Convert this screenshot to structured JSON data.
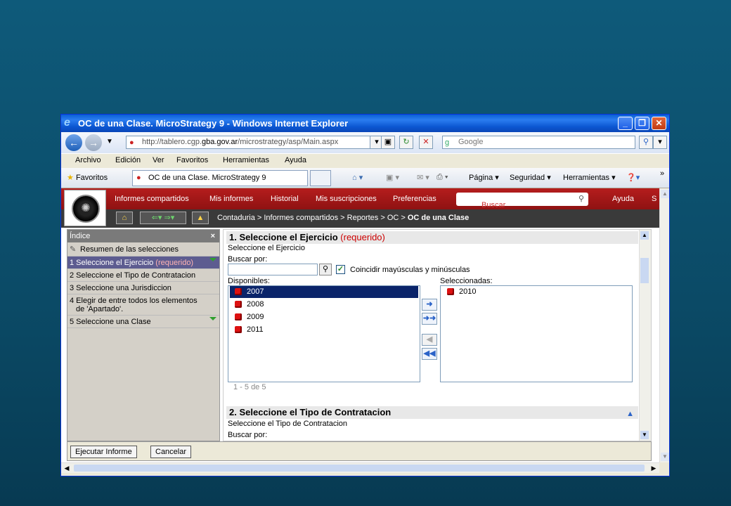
{
  "window": {
    "title": "OC de una Clase. MicroStrategy 9 - Windows Internet Explorer"
  },
  "address": {
    "url_prefix": "http://tablero.cgp.",
    "url_domain": "gba.gov.ar",
    "url_suffix": "/microstrategy/asp/Main.aspx",
    "search_placeholder": "Google"
  },
  "menubar": [
    "Archivo",
    "Edición",
    "Ver",
    "Favoritos",
    "Herramientas",
    "Ayuda"
  ],
  "favbar": {
    "favorites": "Favoritos",
    "tab_title": "OC de una Clase. MicroStrategy 9",
    "tools": [
      "Página ▾",
      "Seguridad ▾",
      "Herramientas ▾"
    ]
  },
  "appnav": {
    "items": [
      "Informes compartidos",
      "Mis informes",
      "Historial",
      "Mis suscripciones",
      "Preferencias"
    ],
    "search_placeholder": "Buscar",
    "help": "Ayuda",
    "extra": "S"
  },
  "breadcrumb": {
    "parts": "Contaduria > Informes compartidos > Reportes > OC > ",
    "current": "OC de una Clase"
  },
  "index": {
    "title": "Índice",
    "close": "×",
    "items": [
      {
        "label": "Resumen de las selecciones"
      },
      {
        "label": "1 Seleccione el Ejercicio",
        "required": "(requerido)"
      },
      {
        "label": "2 Seleccione el Tipo de Contratacion"
      },
      {
        "label": "3 Seleccione una Jurisdiccion"
      },
      {
        "label": "4 Elegir de entre todos los elementos",
        "line2": "de 'Apartado'."
      },
      {
        "label": "5 Seleccione una Clase"
      }
    ]
  },
  "section1": {
    "title": "1. Seleccione el Ejercicio",
    "required": "(requerido)",
    "subtitle": "Seleccione el Ejercicio",
    "search_label": "Buscar por:",
    "match_case": "Coincidir mayúsculas y minúsculas",
    "available_label": "Disponibles:",
    "selected_label": "Seleccionadas:",
    "available": [
      "2007",
      "2008",
      "2009",
      "2011"
    ],
    "selected": [
      "2010"
    ],
    "paging": "1 - 5 de 5"
  },
  "section2": {
    "title": "2. Seleccione el Tipo de Contratacion",
    "subtitle": "Seleccione el Tipo de Contratacion",
    "search_label": "Buscar por:"
  },
  "footer": {
    "run": "Ejecutar Informe",
    "cancel": "Cancelar"
  }
}
